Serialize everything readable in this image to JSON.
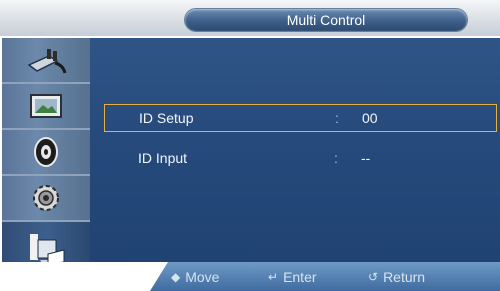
{
  "title": "Multi Control",
  "menu_icons": [
    "plug-icon",
    "picture-icon",
    "speaker-icon",
    "gear-icon",
    "multi-control-icon"
  ],
  "rows": [
    {
      "label": "ID Setup",
      "colon": ":",
      "value": "00"
    },
    {
      "label": "ID Input",
      "colon": ":",
      "value": "--"
    }
  ],
  "footer": {
    "move_icon": "◆",
    "move": "Move",
    "enter_icon": "↵",
    "enter": "Enter",
    "return_icon": "↺",
    "return": "Return"
  }
}
